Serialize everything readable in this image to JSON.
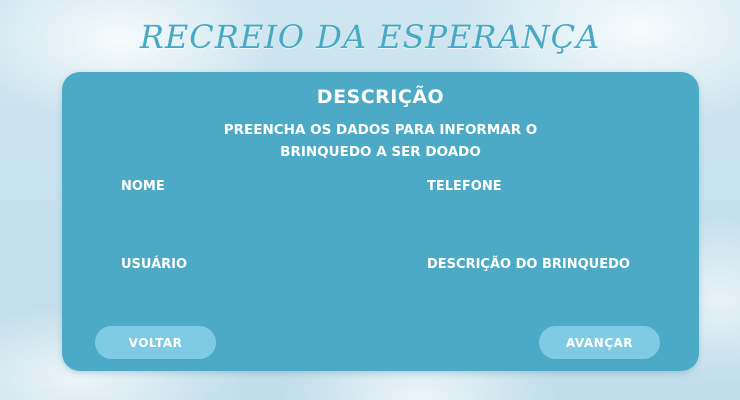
{
  "app": {
    "title": "RECREIO DA ESPERANÇA"
  },
  "form": {
    "heading": "DESCRIÇÃO",
    "subtitle_line1": "PREENCHA OS DADOS PARA INFORMAR O",
    "subtitle_line2": "BRINQUEDO A SER DOADO",
    "fields": {
      "nome": {
        "label": "NOME",
        "value": ""
      },
      "telefone": {
        "label": "TELEFONE",
        "value": ""
      },
      "usuario": {
        "label": "USUÁRIO",
        "value": ""
      },
      "descricao": {
        "label": "DESCRIÇÃO DO BRINQUEDO",
        "value": ""
      }
    },
    "buttons": {
      "back": "VOLTAR",
      "next": "AVANÇAR"
    }
  },
  "colors": {
    "card": "#4daac6",
    "button": "#7fcbe3",
    "title": "#49a9c5",
    "background": "#c9e4ef"
  }
}
